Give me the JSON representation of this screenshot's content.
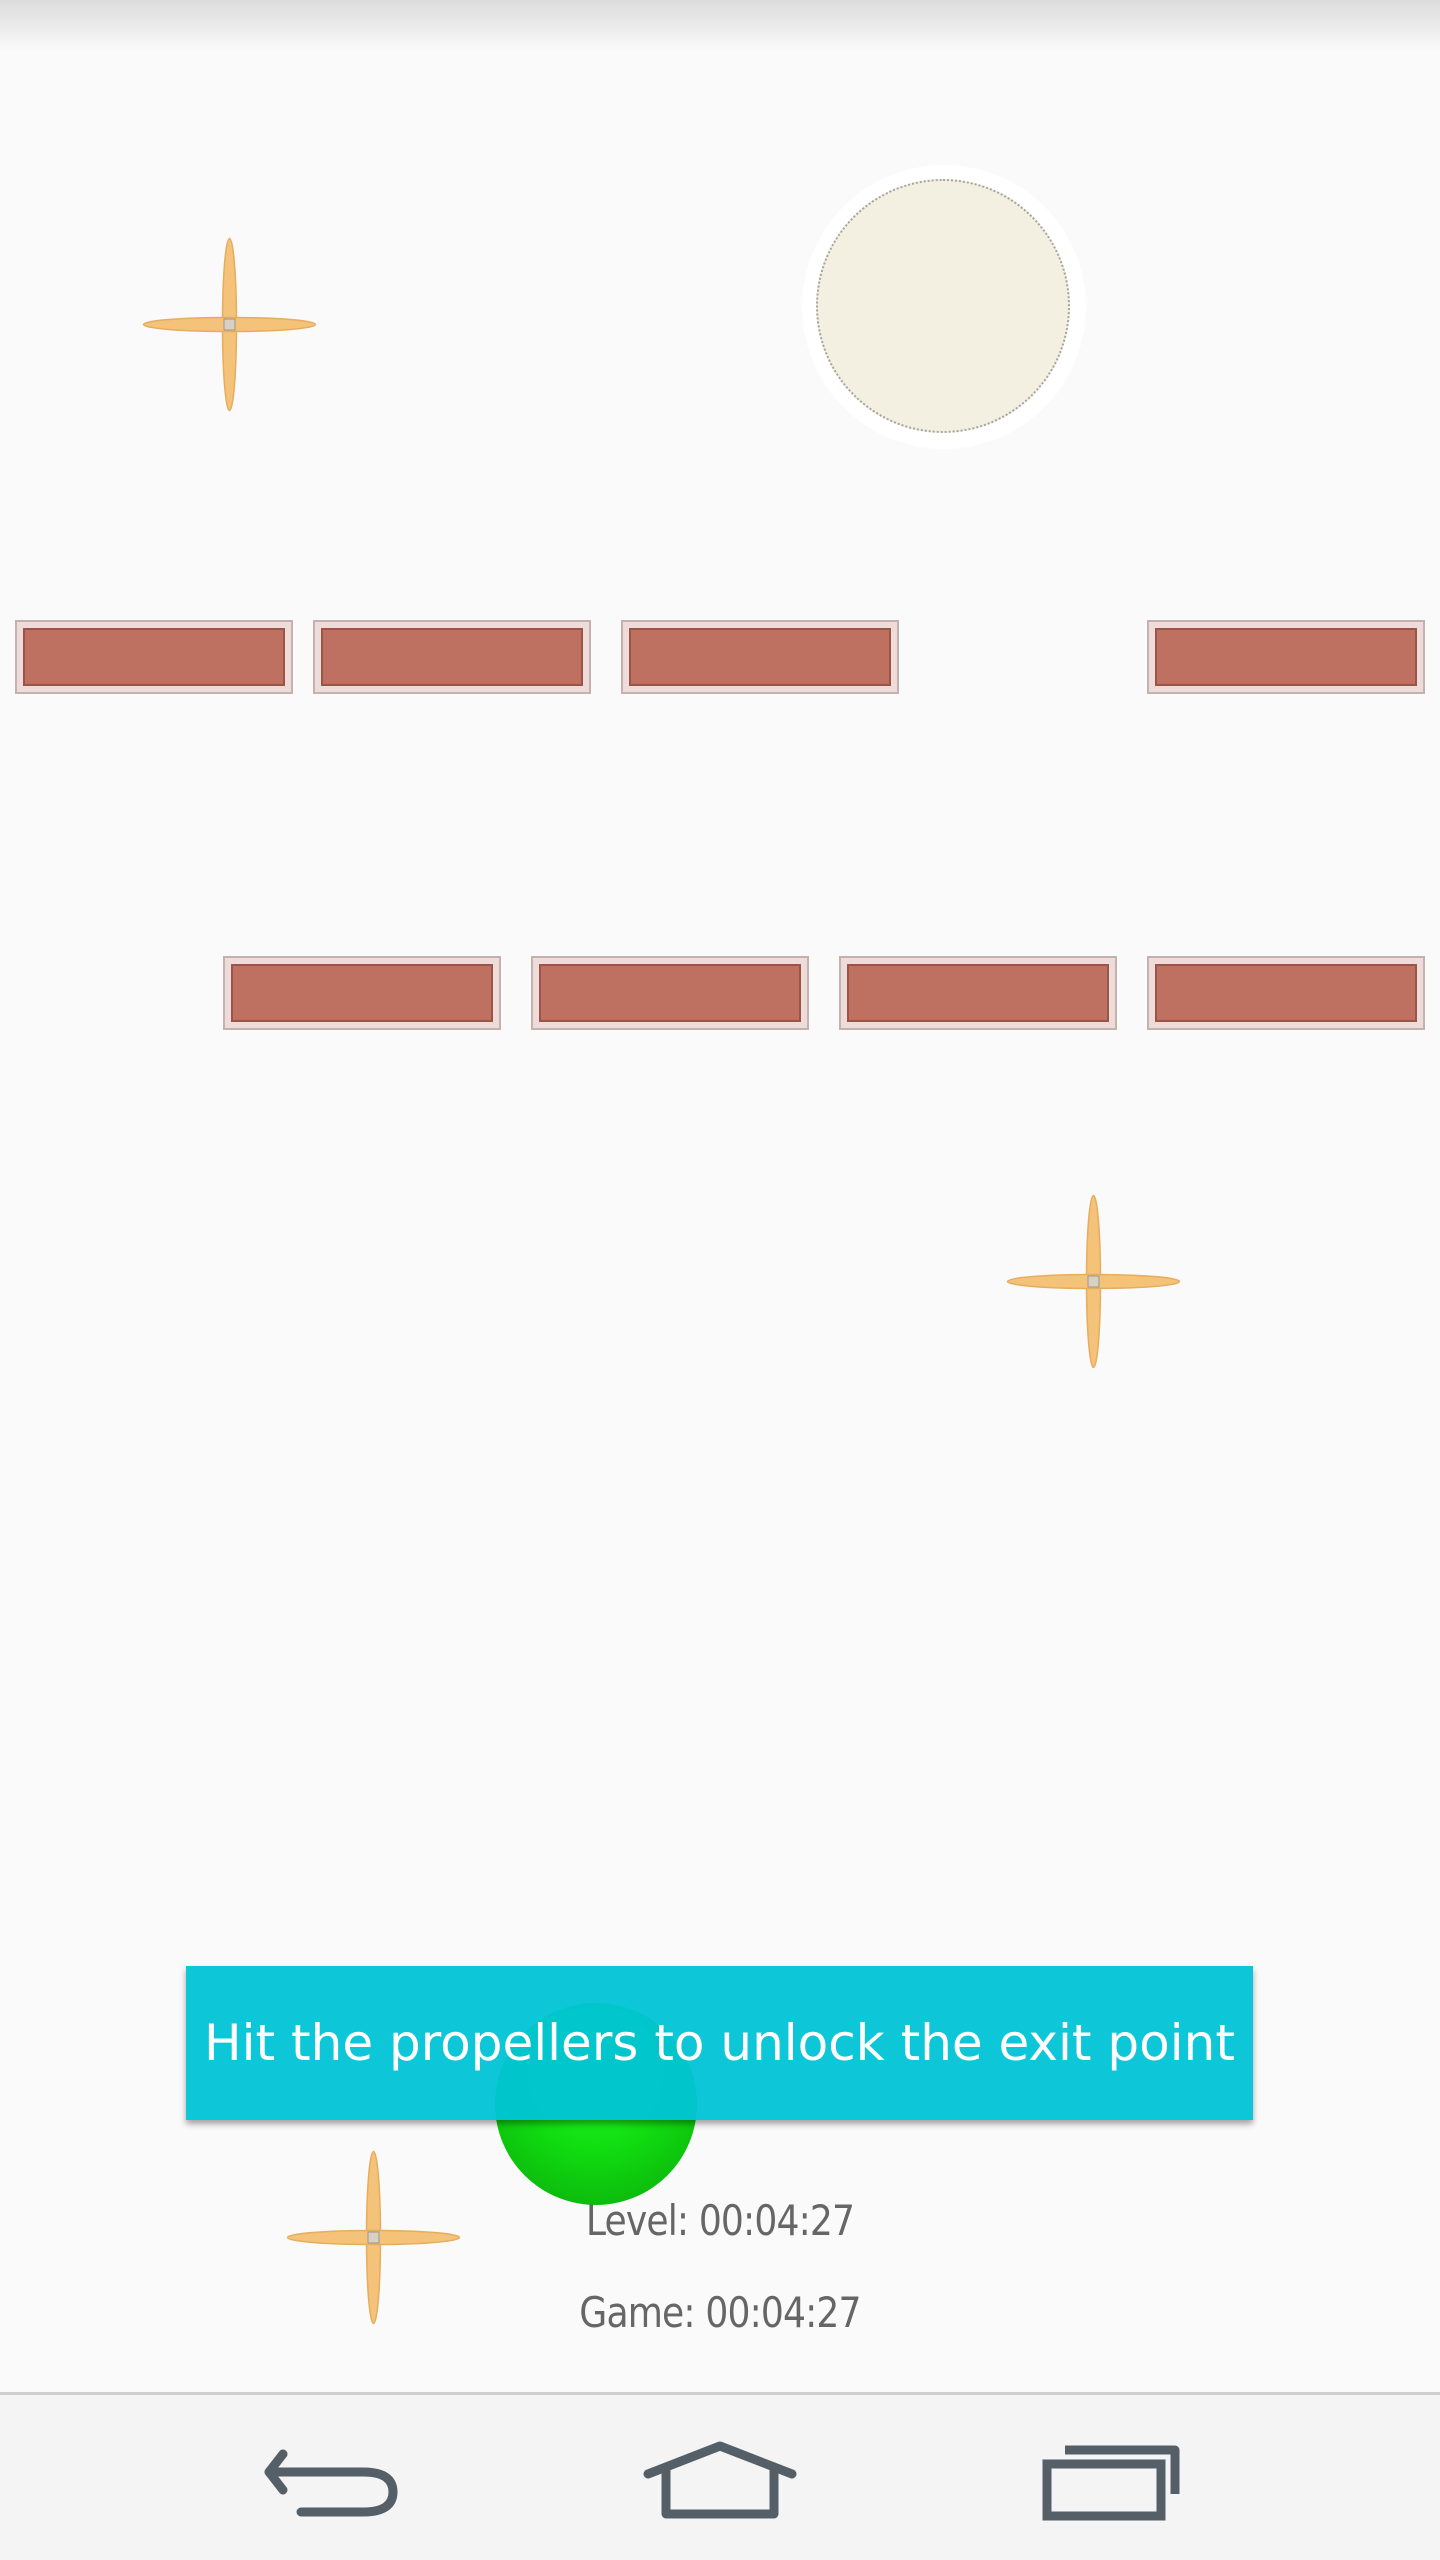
{
  "toast": {
    "message": "Hit the propellers to unlock the exit point"
  },
  "timers": {
    "level": "Level: 00:04:27",
    "game": "Game: 00:04:27"
  },
  "colors": {
    "background": "#fafafa",
    "brick": "#bf7161",
    "propeller": "#f5c27a",
    "exit_point": "#f3efe1",
    "ball": "#11dd11",
    "toast": "#00c4d6",
    "nav_icon": "#545f67"
  },
  "game_objects": {
    "brick_rows": [
      {
        "row": "upper",
        "bricks": 4
      },
      {
        "row": "lower",
        "bricks": 4
      }
    ],
    "propellers": 3,
    "exit_point": "exit-point",
    "ball": "green-ball"
  },
  "nav_bar": {
    "icons": [
      "back-icon",
      "home-icon",
      "recent-apps-icon"
    ]
  }
}
